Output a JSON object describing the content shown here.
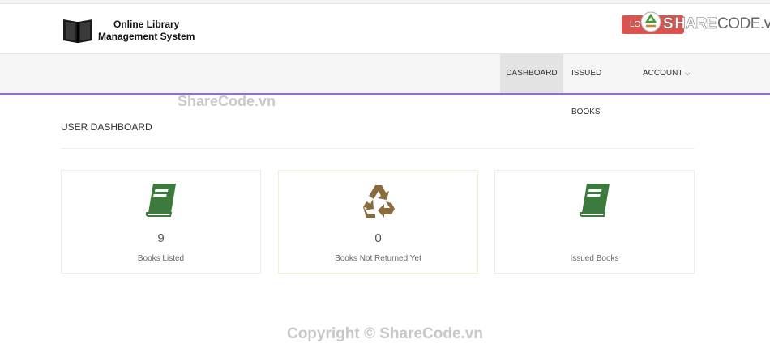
{
  "header": {
    "brand_line1": "Online Library",
    "brand_line2": "Management System",
    "logout_label": "LO",
    "watermark_s": "S",
    "watermark_hare": "HARE",
    "watermark_code": "CODE.vn"
  },
  "nav": {
    "items": [
      {
        "label": "DASHBOARD",
        "active": true
      },
      {
        "label": "ISSUED BOOKS"
      },
      {
        "label": "ACCOUNT"
      }
    ]
  },
  "main": {
    "title": "USER DASHBOARD",
    "cards": [
      {
        "icon": "book-icon",
        "value": "9",
        "label": "Books Listed",
        "color": "#3d7a3d"
      },
      {
        "icon": "recycle-icon",
        "value": "0",
        "label": "Books Not Returned Yet",
        "color": "#8a6b3c"
      },
      {
        "icon": "book-icon",
        "value": "",
        "label": "Issued Books",
        "color": "#3d7a3d"
      }
    ]
  },
  "watermarks": {
    "middle": "ShareCode.vn",
    "footer": "Copyright © ShareCode.vn"
  },
  "colors": {
    "accent_border": "#9170cb",
    "logout_button": "#d9534f"
  }
}
